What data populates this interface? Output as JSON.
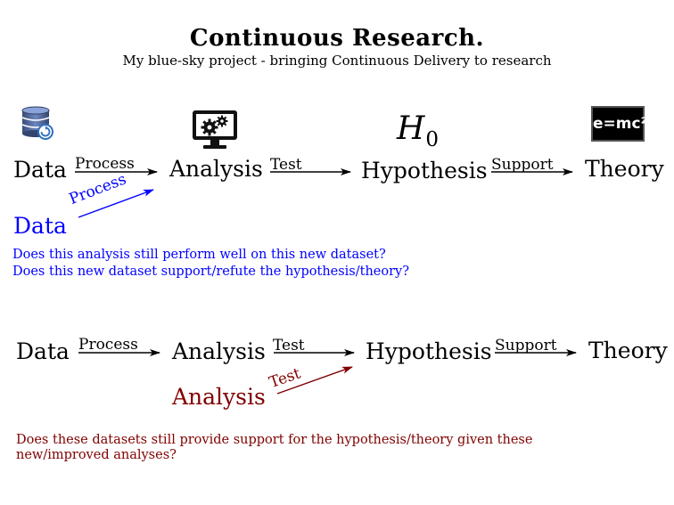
{
  "header": {
    "title": "Continuous Research.",
    "subtitle": "My blue-sky project - bringing Continuous Delivery to research"
  },
  "colors": {
    "blue": "#0000ff",
    "dark_red": "#800000",
    "black": "#000000"
  },
  "icons": [
    "database-icon",
    "monitor-gears-icon",
    "h0-symbol",
    "emc2-chalkboard-icon"
  ],
  "h0": {
    "letter": "H",
    "subscript": "0"
  },
  "emc2": "e=mc²",
  "pipeline1": {
    "nodes": {
      "data": "Data",
      "analysis": "Analysis",
      "hypothesis": "Hypothesis",
      "theory": "Theory"
    },
    "edges": {
      "process": "Process",
      "test": "Test",
      "support": "Support"
    },
    "new_node": "Data",
    "new_edge": "Process",
    "questions": [
      "Does this analysis still perform well on this new dataset?",
      "Does this new dataset support/refute the hypothesis/theory?"
    ]
  },
  "pipeline2": {
    "nodes": {
      "data": "Data",
      "analysis": "Analysis",
      "hypothesis": "Hypothesis",
      "theory": "Theory"
    },
    "edges": {
      "process": "Process",
      "test": "Test",
      "support": "Support"
    },
    "new_node": "Analysis",
    "new_edge": "Test",
    "question": "Does these datasets still provide support for the hypothesis/theory given these new/improved analyses?"
  }
}
